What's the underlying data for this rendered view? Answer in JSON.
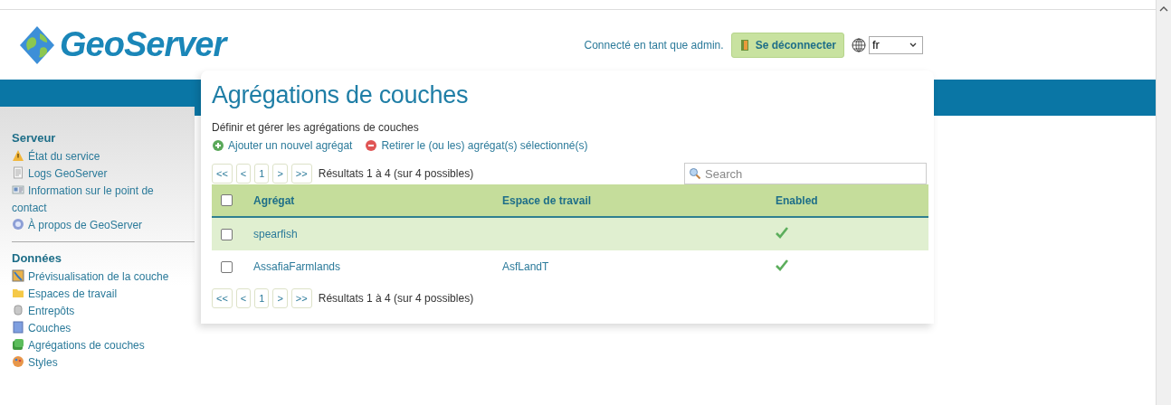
{
  "header": {
    "logo_text": "GeoServer",
    "login_status": "Connecté en tant que admin.",
    "logout_button": "Se déconnecter",
    "language": "fr"
  },
  "sidebar": {
    "sections": [
      {
        "title": "Serveur",
        "items": [
          {
            "label": "État du service",
            "kind": "status"
          },
          {
            "label": "Logs GeoServer",
            "kind": "logs"
          },
          {
            "label": "Information sur le point de contact",
            "kind": "contact"
          },
          {
            "label": "À propos de GeoServer",
            "kind": "about"
          }
        ]
      },
      {
        "title": "Données",
        "items": [
          {
            "label": "Prévisualisation de la couche",
            "kind": "preview"
          },
          {
            "label": "Espaces de travail",
            "kind": "workspaces"
          },
          {
            "label": "Entrepôts",
            "kind": "stores"
          },
          {
            "label": "Couches",
            "kind": "layers"
          },
          {
            "label": "Agrégations de couches",
            "kind": "groups"
          },
          {
            "label": "Styles",
            "kind": "styles"
          }
        ]
      }
    ]
  },
  "page": {
    "title": "Agrégations de couches",
    "description": "Définir et gérer les agrégations de couches",
    "actions": [
      {
        "label": "Ajouter un nouvel agrégat",
        "kind": "add"
      },
      {
        "label": "Retirer le (ou les) agrégat(s) sélectionné(s)",
        "kind": "remove"
      }
    ],
    "pager_top": {
      "buttons": [
        "<<",
        "<",
        "1",
        ">",
        ">>"
      ],
      "results": "Résultats 1 à 4 (sur 4 possibles)"
    },
    "search": {
      "placeholder": "Search"
    },
    "table": {
      "header_checked": false,
      "columns": [
        "Agrégat",
        "Espace de travail",
        "Enabled"
      ],
      "rows": [
        {
          "checked": false,
          "name": "spearfish",
          "workspace": "",
          "enabled": true
        },
        {
          "checked": false,
          "name": "AssafiaFarmlands",
          "workspace": "AsfLandT",
          "enabled": true
        }
      ]
    },
    "pager_bottom": {
      "buttons": [
        "<<",
        "<",
        "1",
        ">",
        ">>"
      ],
      "results": "Résultats 1 à 4 (sur 4 possibles)"
    }
  }
}
